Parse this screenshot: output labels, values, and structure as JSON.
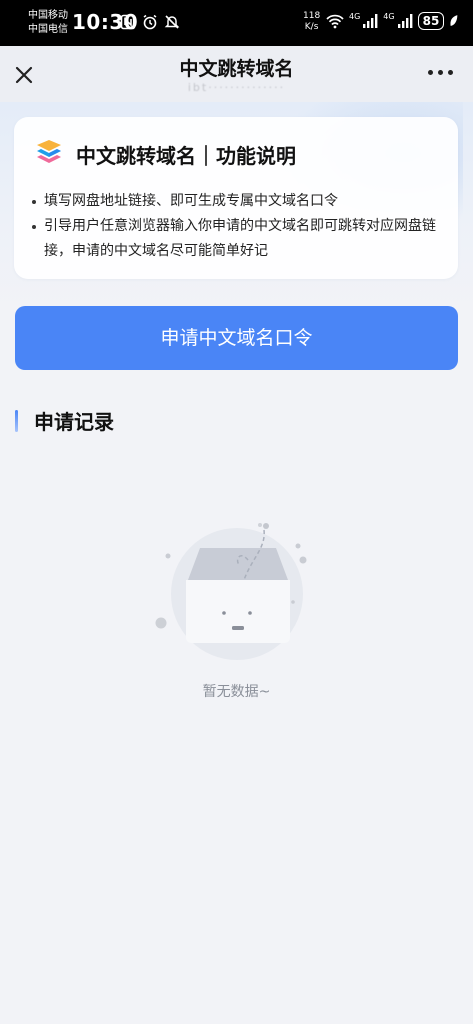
{
  "status_bar": {
    "carrier_1": "中国移动",
    "carrier_2": "中国电信",
    "time": "10:30",
    "speed_value": "118",
    "speed_unit": "K/s",
    "network_1": "4G",
    "network_2": "4G",
    "battery": "85",
    "icons": [
      "nfc-icon",
      "alarm-icon",
      "mute-icon",
      "wifi-icon",
      "signal-icon",
      "battery-icon",
      "leaf-icon"
    ]
  },
  "header": {
    "title": "中文跳转域名",
    "subtitle": "ibt··············"
  },
  "info_card": {
    "title": "中文跳转域名｜功能说明",
    "bullets": [
      "填写网盘地址链接、即可生成专属中文域名口令",
      "引导用户任意浏览器输入你申请的中文域名即可跳转对应网盘链接，申请的中文域名尽可能简单好记"
    ]
  },
  "apply_button": {
    "label": "申请中文域名口令"
  },
  "records": {
    "section_title": "申请记录",
    "empty_text": "暂无数据~"
  },
  "colors": {
    "accent": "#4a85f6",
    "page_bg": "#f2f3f7",
    "status_bar_bg": "#000000",
    "muted_text": "#8a8f99"
  }
}
